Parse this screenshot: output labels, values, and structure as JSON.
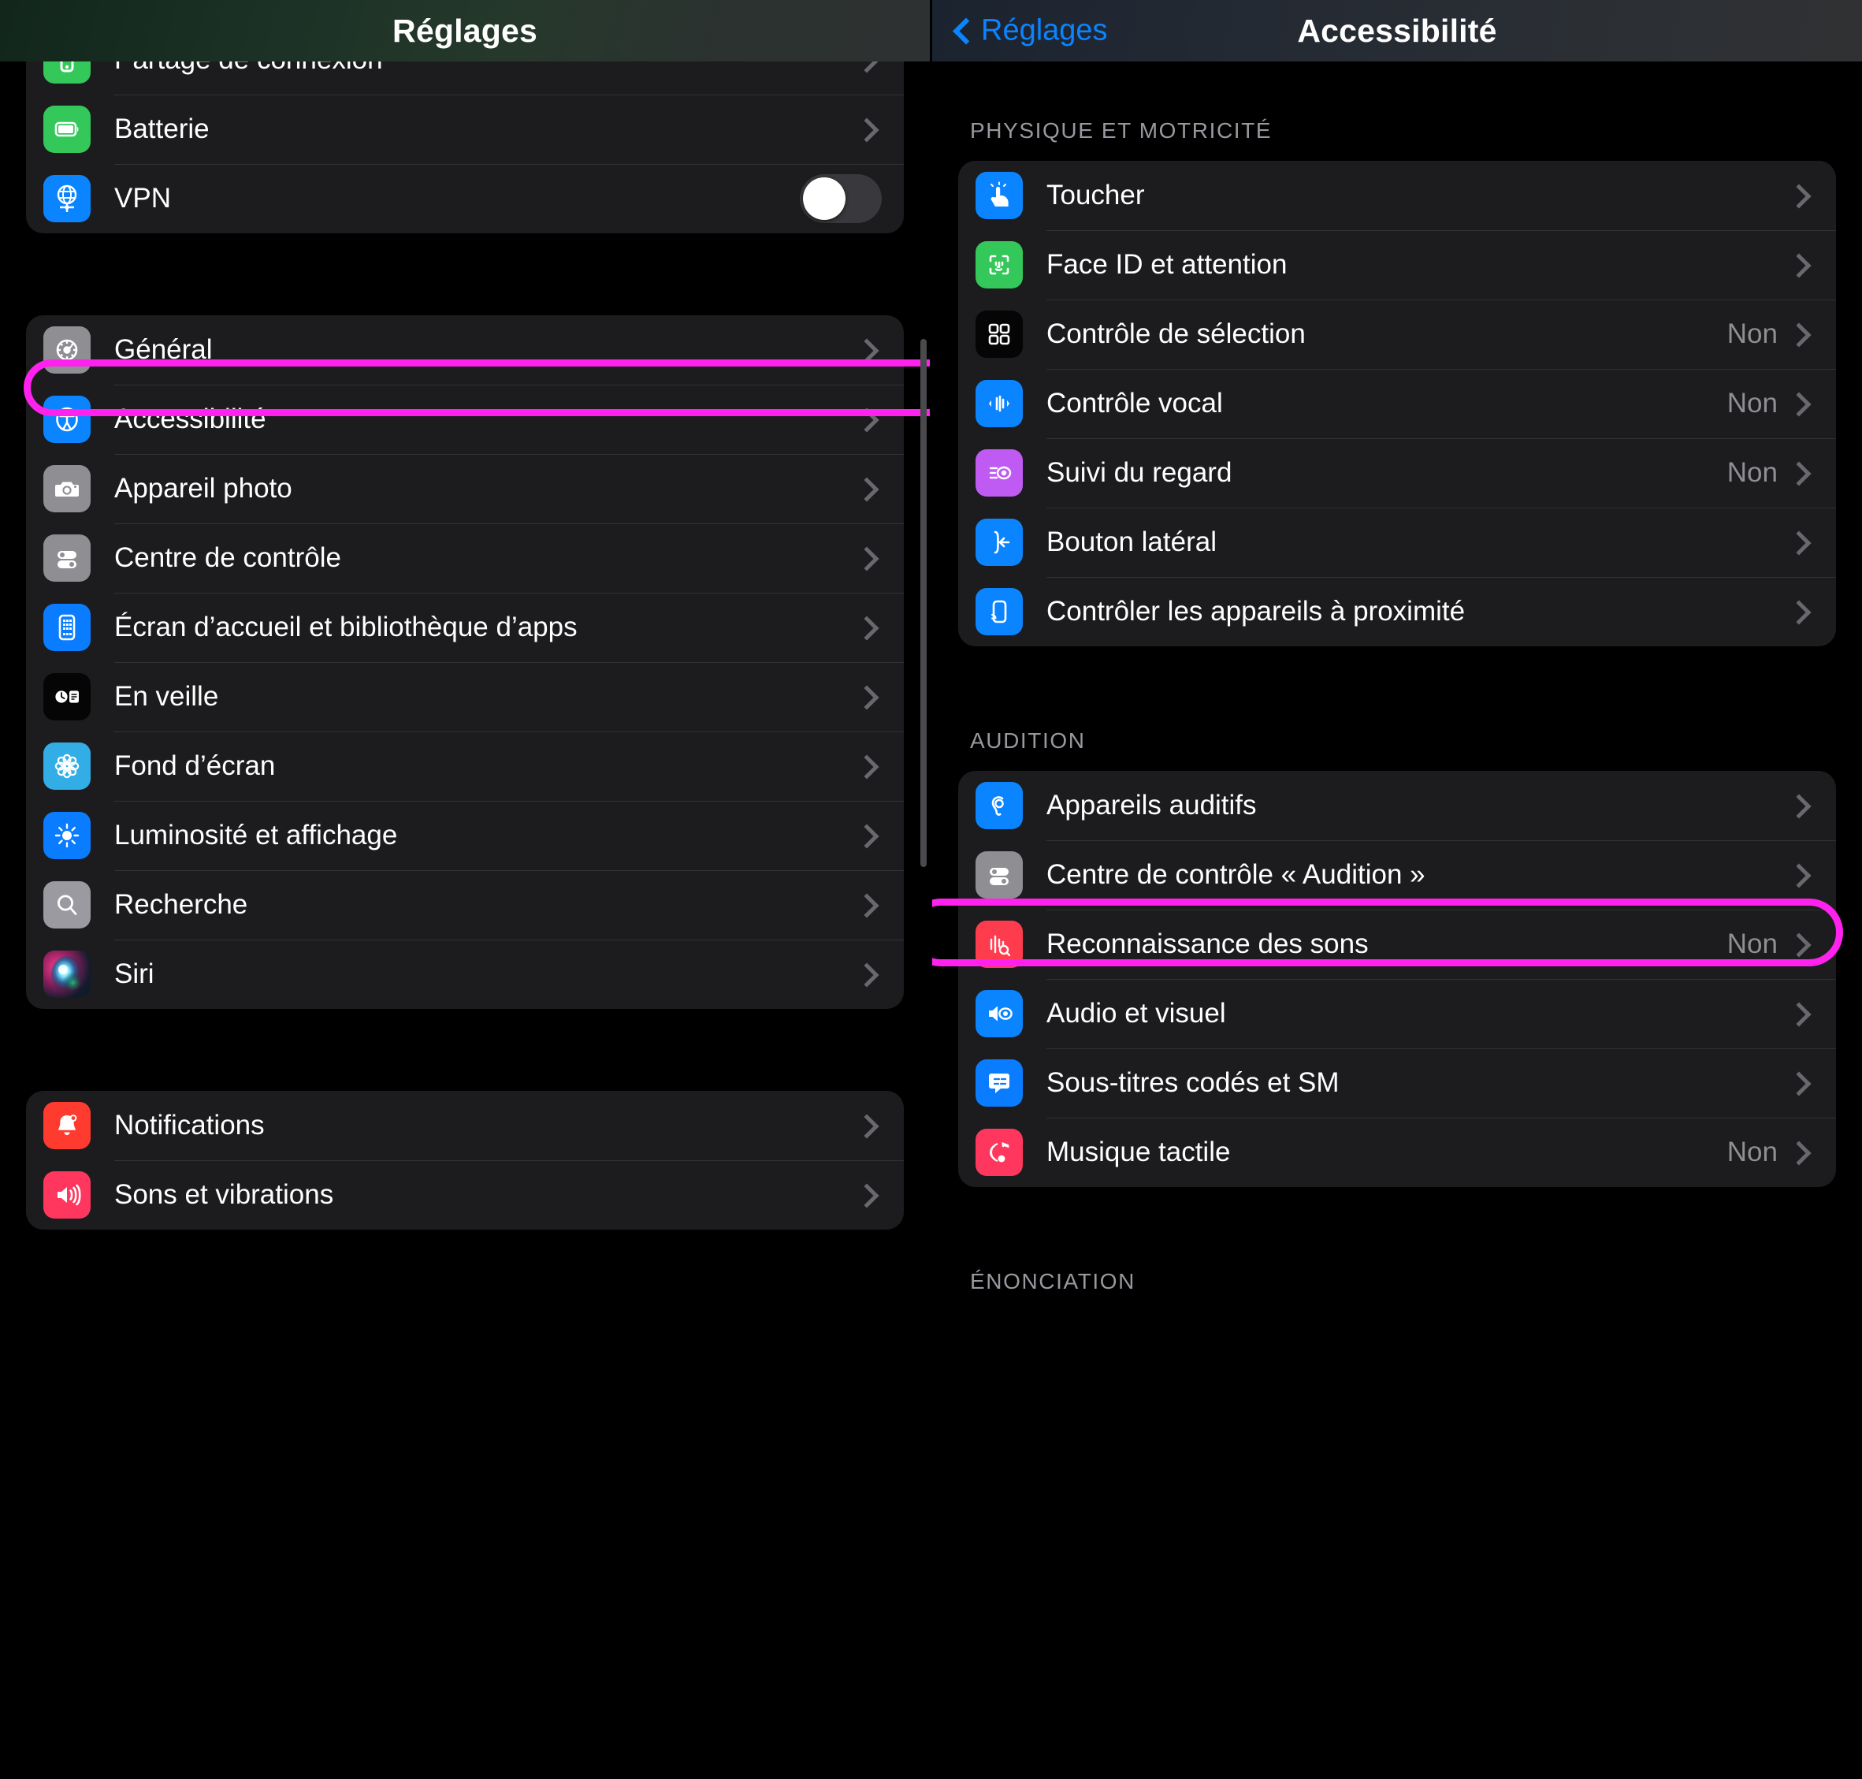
{
  "left_panel": {
    "navbar": {
      "title": "Réglages"
    },
    "highlight_color": "#ff22ee",
    "group1": {
      "rows": [
        {
          "label": "Partage de connexion",
          "icon": "hotspot-icon",
          "icon_bg": "#34c759",
          "accessory": "chevron",
          "clipped": true
        },
        {
          "label": "Batterie",
          "icon": "battery-icon",
          "icon_bg": "#34c759",
          "accessory": "chevron"
        },
        {
          "label": "VPN",
          "icon": "vpn-globe-icon",
          "icon_bg": "#0a84ff",
          "accessory": "switch",
          "switch_on": "false"
        }
      ]
    },
    "group2": {
      "rows": [
        {
          "label": "Général",
          "icon": "gear-icon",
          "icon_bg": "#8e8e93",
          "accessory": "chevron"
        },
        {
          "label": "Accessibilité",
          "icon": "accessibility-icon",
          "icon_bg": "#0a84ff",
          "accessory": "chevron",
          "highlighted": true
        },
        {
          "label": "Appareil photo",
          "icon": "camera-icon",
          "icon_bg": "#8e8e93",
          "accessory": "chevron"
        },
        {
          "label": "Centre de contrôle",
          "icon": "control-center-icon",
          "icon_bg": "#8e8e93",
          "accessory": "chevron"
        },
        {
          "label": "Écran d’accueil et bibliothèque d’apps",
          "icon": "home-screen-icon",
          "icon_bg": "#0a84ff",
          "accessory": "chevron"
        },
        {
          "label": "En veille",
          "icon": "standby-icon",
          "icon_bg": "#000000",
          "accessory": "chevron"
        },
        {
          "label": "Fond d’écran",
          "icon": "wallpaper-flower-icon",
          "icon_bg": "#32ade6",
          "accessory": "chevron"
        },
        {
          "label": "Luminosité et affichage",
          "icon": "brightness-sun-icon",
          "icon_bg": "#0a7cff",
          "accessory": "chevron"
        },
        {
          "label": "Recherche",
          "icon": "search-magnifier-icon",
          "icon_bg": "#9a9aa0",
          "accessory": "chevron"
        },
        {
          "label": "Siri",
          "icon": "siri-orb-icon",
          "icon_bg": "#2a1f3d",
          "accessory": "chevron"
        }
      ]
    },
    "group3": {
      "rows": [
        {
          "label": "Notifications",
          "icon": "notification-bell-icon",
          "icon_bg": "#ff3b30",
          "accessory": "chevron"
        },
        {
          "label": "Sons et vibrations",
          "icon": "speaker-waves-icon",
          "icon_bg": "#ff375f",
          "accessory": "chevron"
        }
      ]
    }
  },
  "right_panel": {
    "navbar": {
      "back_label": "Réglages",
      "title": "Accessibilité"
    },
    "sections": [
      {
        "header": "PHYSIQUE ET MOTRICITÉ",
        "rows": [
          {
            "label": "Toucher",
            "icon": "touch-hand-icon",
            "icon_bg": "#0a84ff",
            "value": "",
            "accessory": "chevron"
          },
          {
            "label": "Face ID et attention",
            "icon": "face-id-icon",
            "icon_bg": "#34c759",
            "value": "",
            "accessory": "chevron"
          },
          {
            "label": "Contrôle de sélection",
            "icon": "switch-control-icon",
            "icon_bg": "#000000",
            "value": "Non",
            "accessory": "chevron"
          },
          {
            "label": "Contrôle vocal",
            "icon": "voice-control-icon",
            "icon_bg": "#0a84ff",
            "value": "Non",
            "accessory": "chevron"
          },
          {
            "label": "Suivi du regard",
            "icon": "eye-tracking-icon",
            "icon_bg": "#bf5af2",
            "value": "Non",
            "accessory": "chevron"
          },
          {
            "label": "Bouton latéral",
            "icon": "side-button-icon",
            "icon_bg": "#0a84ff",
            "value": "",
            "accessory": "chevron"
          },
          {
            "label": "Contrôler les appareils à proximité",
            "icon": "nearby-devices-icon",
            "icon_bg": "#0a84ff",
            "value": "",
            "accessory": "chevron"
          }
        ]
      },
      {
        "header": "AUDITION",
        "rows": [
          {
            "label": "Appareils auditifs",
            "icon": "hearing-aid-icon",
            "icon_bg": "#0a84ff",
            "value": "",
            "accessory": "chevron"
          },
          {
            "label": "Centre de contrôle « Audition »",
            "icon": "control-center-icon",
            "icon_bg": "#8e8e93",
            "value": "",
            "accessory": "chevron"
          },
          {
            "label": "Reconnaissance des sons",
            "icon": "sound-recognition-icon",
            "icon_bg": "#ff3b4e",
            "value": "Non",
            "accessory": "chevron"
          },
          {
            "label": "Audio et visuel",
            "icon": "audio-visual-icon",
            "icon_bg": "#0a84ff",
            "value": "",
            "accessory": "chevron",
            "highlighted": true
          },
          {
            "label": "Sous-titres codés et SM",
            "icon": "closed-captions-icon",
            "icon_bg": "#0a84ff",
            "value": "",
            "accessory": "chevron"
          },
          {
            "label": "Musique tactile",
            "icon": "haptic-music-icon",
            "icon_bg": "#ff375f",
            "value": "Non",
            "accessory": "chevron"
          }
        ]
      },
      {
        "header": "ÉNONCIATION",
        "rows": []
      }
    ]
  }
}
